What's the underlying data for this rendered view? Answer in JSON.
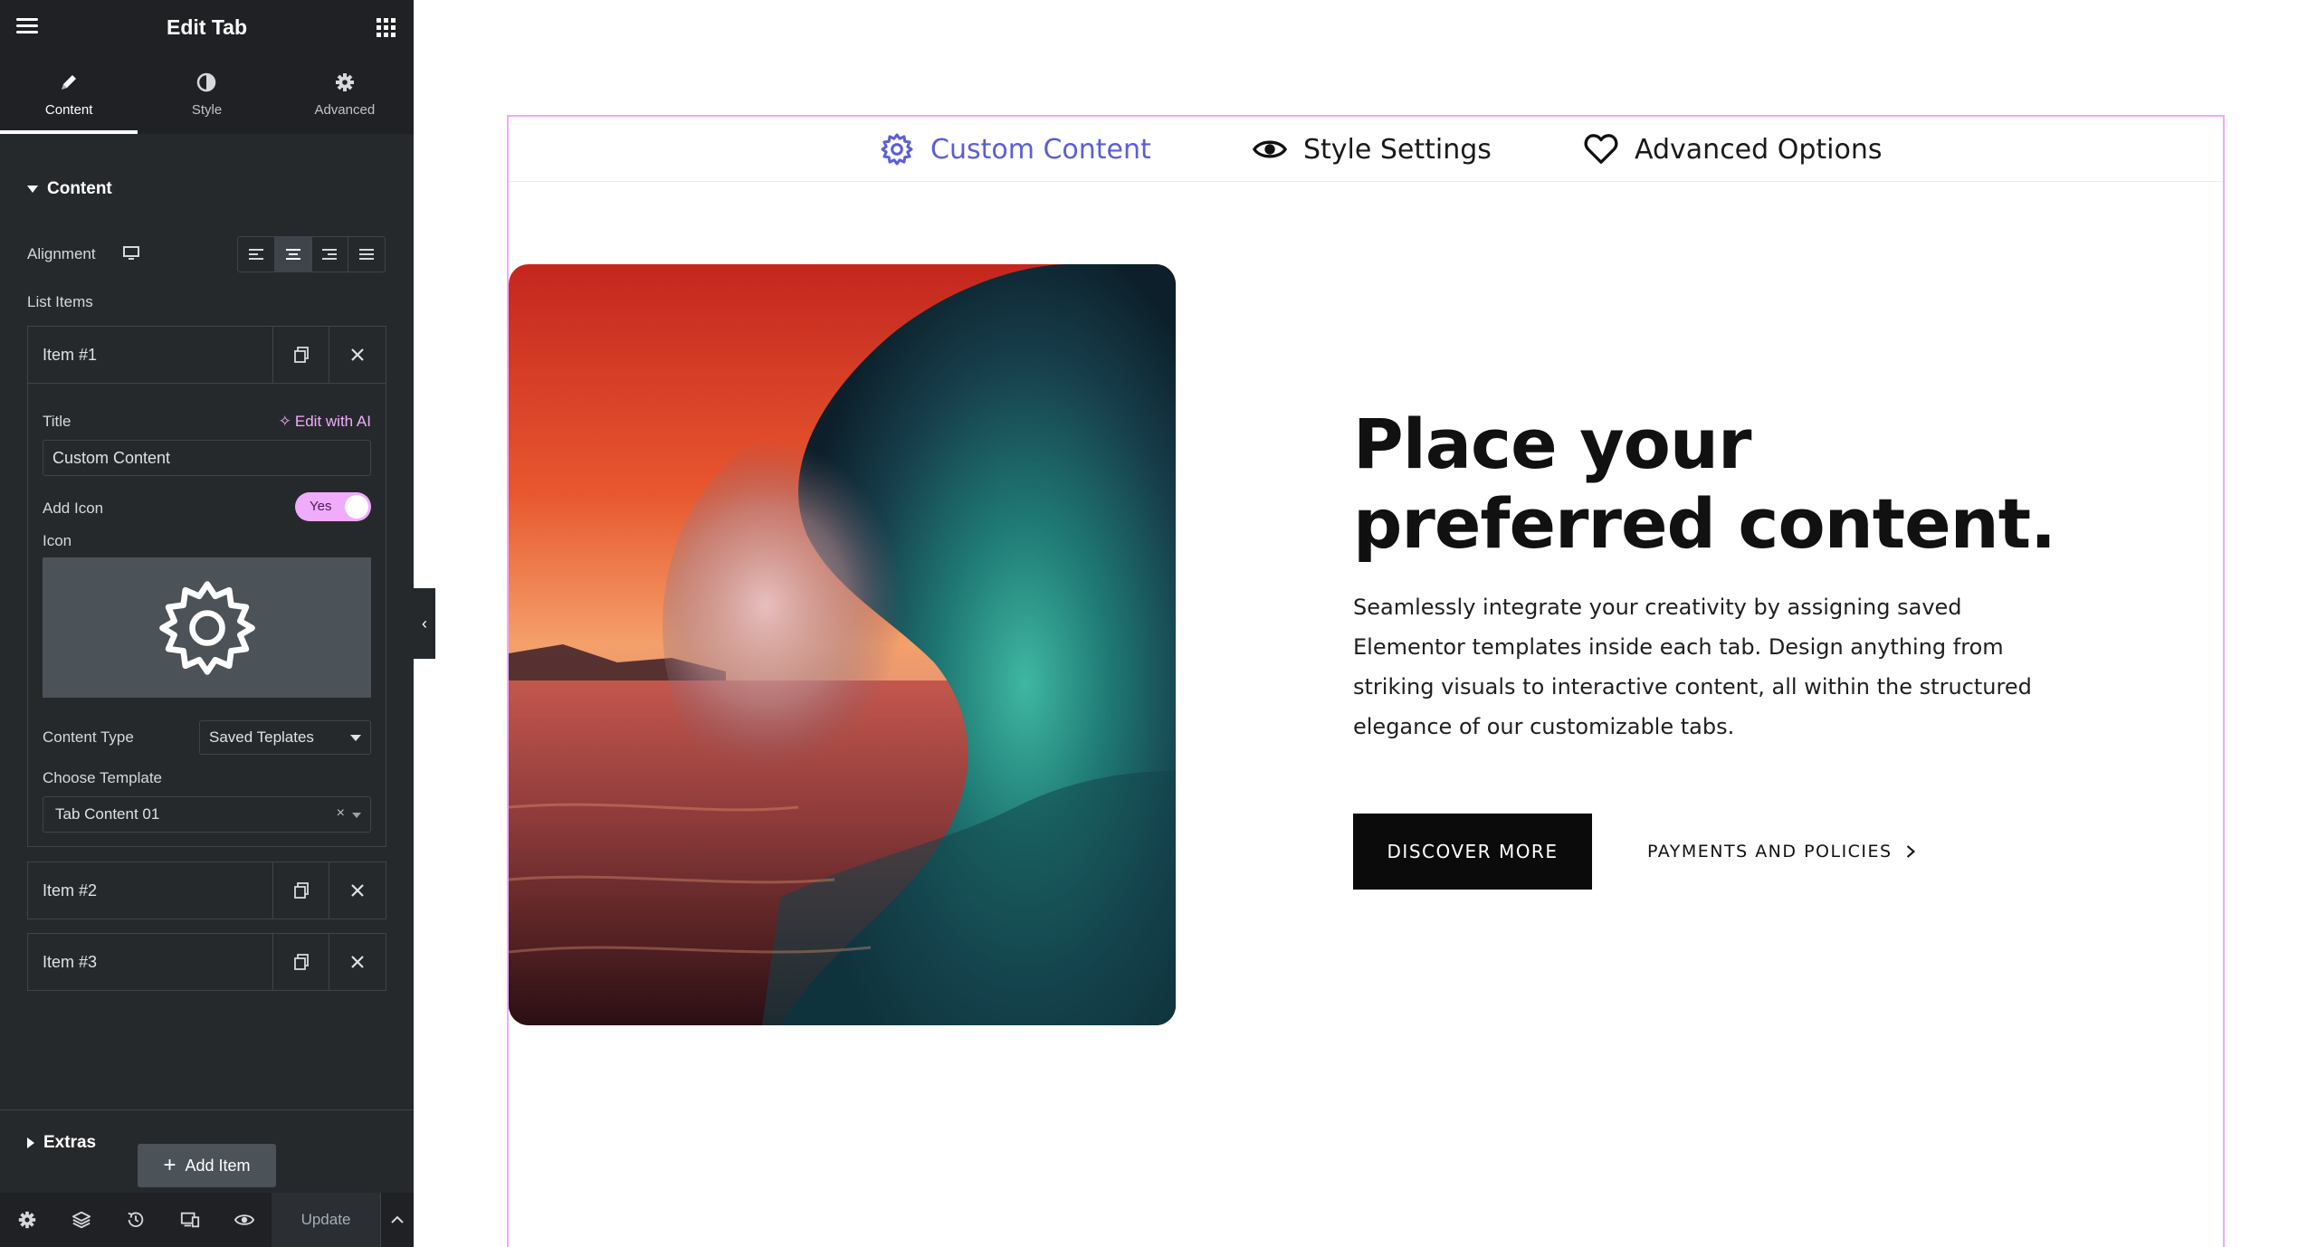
{
  "sidebar": {
    "header": {
      "title": "Edit Tab",
      "menu_icon": "hamburger-icon",
      "apps_icon": "grid-icon"
    },
    "tabs": [
      {
        "label": "Content",
        "icon": "pencil-icon",
        "active": true
      },
      {
        "label": "Style",
        "icon": "contrast-icon",
        "active": false
      },
      {
        "label": "Advanced",
        "icon": "gear-icon",
        "active": false
      }
    ],
    "content_section": {
      "title": "Content",
      "alignment_label": "Alignment",
      "list_items_label": "List Items",
      "items": [
        {
          "label": "Item #1"
        },
        {
          "label": "Item #2"
        },
        {
          "label": "Item #3"
        }
      ],
      "item1": {
        "title_label": "Title",
        "edit_ai_label": "Edit with AI",
        "title_value": "Custom Content",
        "add_icon_label": "Add Icon",
        "toggle_label": "Yes",
        "icon_label": "Icon",
        "content_type_label": "Content Type",
        "content_type_value": "Saved Teplates",
        "choose_template_label": "Choose Template",
        "template_value": "Tab Content 01",
        "template_clear": "×"
      },
      "add_item_label": "Add Item"
    },
    "extras_section": {
      "title": "Extras"
    },
    "footer": {
      "update_label": "Update"
    }
  },
  "canvas": {
    "tabs": [
      {
        "label": "Custom Content",
        "icon": "gear-icon",
        "active": true
      },
      {
        "label": "Style Settings",
        "icon": "eye-icon",
        "active": false
      },
      {
        "label": "Advanced Options",
        "icon": "heart-icon",
        "active": false
      }
    ],
    "heading_line1": "Place your",
    "heading_line2": "preferred content.",
    "body": "Seamlessly integrate your creativity by assigning saved Elementor templates inside each tab. Design anything from striking visuals to interactive content, all within the structured elegance of our customizable tabs.",
    "primary_button": "DISCOVER MORE",
    "secondary_link": "PAYMENTS AND POLICIES"
  },
  "colors": {
    "accent": "#5b5ed8",
    "toggle": "#f0abfc",
    "panel_bg": "#26292c",
    "button_dark": "#0b0b0b"
  }
}
